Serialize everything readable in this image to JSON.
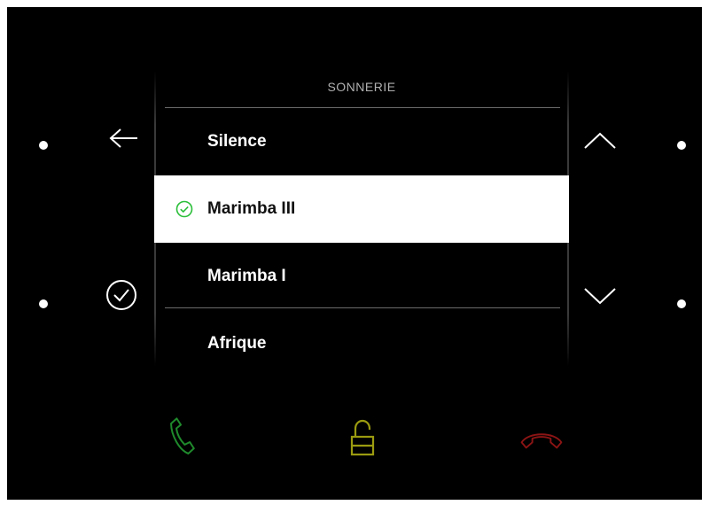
{
  "header": {
    "title": "SONNERIE"
  },
  "list": {
    "items": [
      {
        "label": "Silence",
        "selected": false
      },
      {
        "label": "Marimba III",
        "selected": true
      },
      {
        "label": "Marimba I",
        "selected": false
      },
      {
        "label": "Afrique",
        "selected": false
      }
    ]
  },
  "buttons": {
    "left_top": "back-arrow-icon",
    "left_bottom": "confirm-check-icon",
    "right_top": "chevron-up-icon",
    "right_bottom": "chevron-down-icon",
    "call": "phone-answer-icon",
    "unlock": "padlock-open-icon",
    "hangup": "phone-hangup-icon"
  },
  "colors": {
    "background": "#000000",
    "selected_row": "#ffffff",
    "check_accent": "#2bbf3a",
    "call_green": "#1f8a2c",
    "unlock_yellow": "#9a9a10",
    "hangup_red": "#8c1414"
  }
}
